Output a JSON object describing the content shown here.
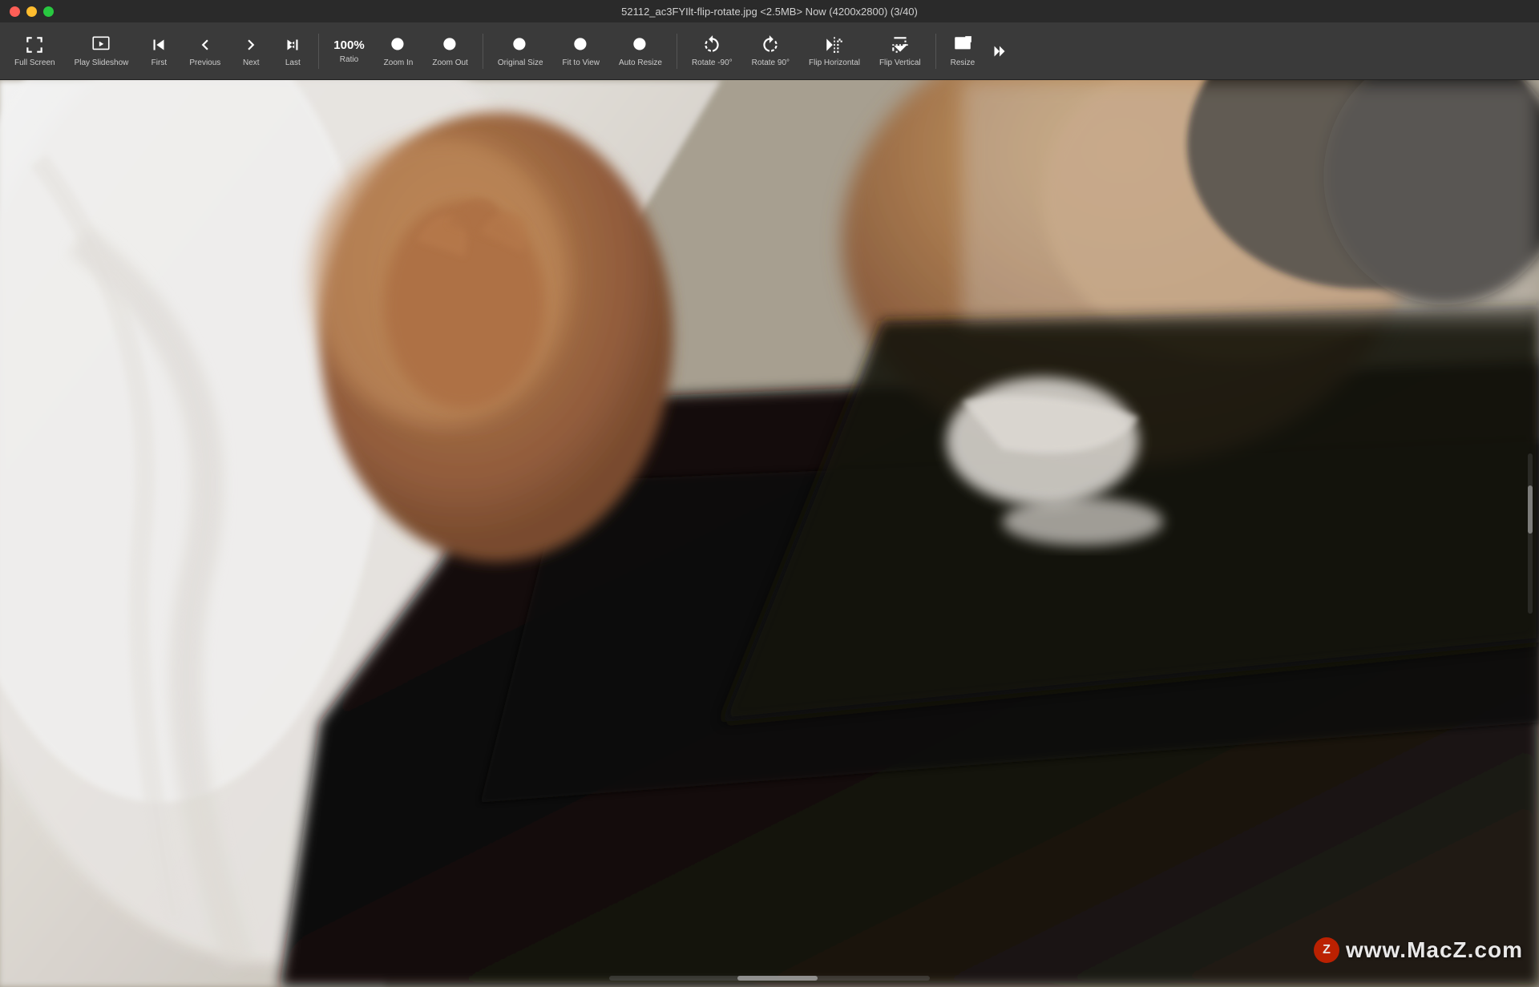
{
  "window": {
    "title": "52112_ac3FYIlt-flip-rotate.jpg <2.5MB> Now (4200x2800) (3/40)"
  },
  "toolbar": {
    "buttons": [
      {
        "id": "fullscreen",
        "label": "Full Screen",
        "icon": "fullscreen"
      },
      {
        "id": "play-slideshow",
        "label": "Play Slideshow",
        "icon": "play"
      },
      {
        "id": "first",
        "label": "First",
        "icon": "first"
      },
      {
        "id": "previous",
        "label": "Previous",
        "icon": "prev"
      },
      {
        "id": "next",
        "label": "Next",
        "icon": "next"
      },
      {
        "id": "last",
        "label": "Last",
        "icon": "last"
      }
    ],
    "ratio": "100%",
    "ratio_label": "Ratio",
    "zoom_buttons": [
      {
        "id": "zoom-in",
        "label": "Zoom In",
        "icon": "zoomin"
      },
      {
        "id": "zoom-out",
        "label": "Zoom Out",
        "icon": "zoomout"
      }
    ],
    "view_buttons": [
      {
        "id": "original-size",
        "label": "Original Size",
        "icon": "original"
      },
      {
        "id": "fit-to-view",
        "label": "Fit to View",
        "icon": "fitview"
      },
      {
        "id": "auto-resize",
        "label": "Auto Resize",
        "icon": "autoresize"
      }
    ],
    "transform_buttons": [
      {
        "id": "rotate-neg90",
        "label": "Rotate -90°",
        "icon": "rotateccw"
      },
      {
        "id": "rotate-90",
        "label": "Rotate 90°",
        "icon": "rotatecw"
      },
      {
        "id": "flip-horizontal",
        "label": "Flip Horizontal",
        "icon": "fliph"
      },
      {
        "id": "flip-vertical",
        "label": "Flip Vertical",
        "icon": "flipv"
      }
    ],
    "resize_label": "Resize",
    "more_label": "»"
  },
  "watermark": {
    "logo": "Z",
    "text": "www.MacZ.com"
  },
  "image": {
    "filename": "52112_ac3FYIlt-flip-rotate.jpg",
    "size": "<2.5MB>",
    "timestamp": "Now",
    "dimensions": "(4200x2800)",
    "position": "(3/40)"
  }
}
